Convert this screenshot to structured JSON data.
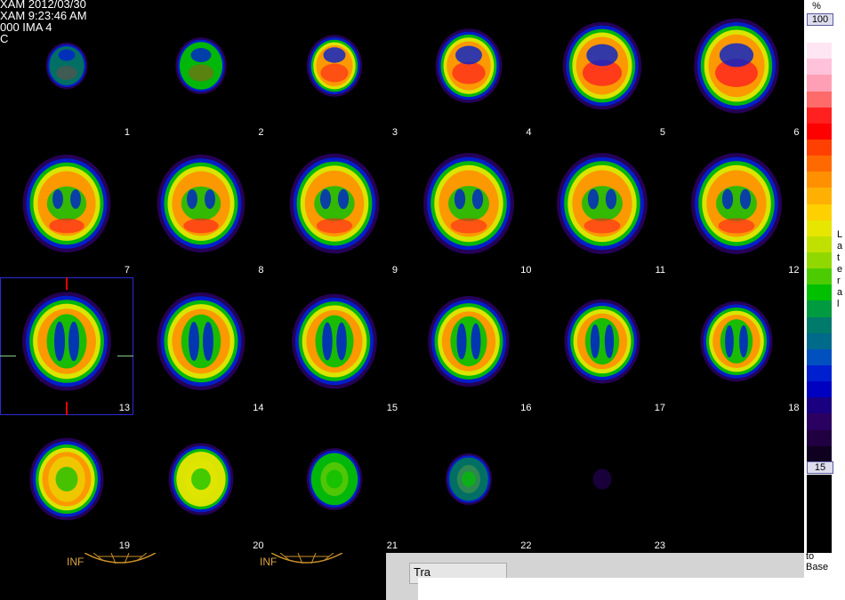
{
  "header": {
    "line1": "XAM 2012/03/30",
    "line2": "XAM 9:23:46 AM",
    "line3": "000 IMA 4",
    "line4": "C"
  },
  "slices": [
    {
      "num": "1",
      "intensity": 0.25,
      "size": 0.45
    },
    {
      "num": "2",
      "intensity": 0.35,
      "size": 0.55
    },
    {
      "num": "3",
      "intensity": 0.6,
      "size": 0.6
    },
    {
      "num": "4",
      "intensity": 0.7,
      "size": 0.72
    },
    {
      "num": "5",
      "intensity": 0.78,
      "size": 0.85
    },
    {
      "num": "6",
      "intensity": 0.8,
      "size": 0.92
    },
    {
      "num": "7",
      "intensity": 0.82,
      "size": 0.95
    },
    {
      "num": "8",
      "intensity": 0.8,
      "size": 0.95
    },
    {
      "num": "9",
      "intensity": 0.72,
      "size": 0.97
    },
    {
      "num": "10",
      "intensity": 0.72,
      "size": 0.98
    },
    {
      "num": "11",
      "intensity": 0.74,
      "size": 0.98
    },
    {
      "num": "12",
      "intensity": 0.74,
      "size": 0.98
    },
    {
      "num": "13",
      "intensity": 0.7,
      "size": 0.96
    },
    {
      "num": "14",
      "intensity": 0.7,
      "size": 0.95
    },
    {
      "num": "15",
      "intensity": 0.68,
      "size": 0.92
    },
    {
      "num": "16",
      "intensity": 0.66,
      "size": 0.88
    },
    {
      "num": "17",
      "intensity": 0.64,
      "size": 0.82
    },
    {
      "num": "18",
      "intensity": 0.6,
      "size": 0.78
    },
    {
      "num": "19",
      "intensity": 0.6,
      "size": 0.8
    },
    {
      "num": "20",
      "intensity": 0.5,
      "size": 0.7
    },
    {
      "num": "21",
      "intensity": 0.35,
      "size": 0.6
    },
    {
      "num": "22",
      "intensity": 0.2,
      "size": 0.5
    },
    {
      "num": "23",
      "intensity": 0.05,
      "size": 0.2
    }
  ],
  "scale": {
    "pct_label": "%",
    "max_value": "100",
    "min_value": "15",
    "lateral_label": "Lateral",
    "to_label": "to",
    "base_label": "Base",
    "colors": [
      "#ffffff",
      "#ffe6f2",
      "#ffc2d8",
      "#ff9fb5",
      "#ff6a6a",
      "#ff2020",
      "#ff0000",
      "#ff4000",
      "#ff6a00",
      "#ff9000",
      "#ffb000",
      "#ffd000",
      "#e6e600",
      "#c0e000",
      "#90d800",
      "#4ccc00",
      "#00c000",
      "#009a40",
      "#007a6a",
      "#006a8a",
      "#0050c0",
      "#0020d0",
      "#0000c0",
      "#1a0080",
      "#2a0060",
      "#200040",
      "#100020"
    ]
  },
  "bottom": {
    "inf_label": "INF",
    "tab_label": "Tra"
  }
}
